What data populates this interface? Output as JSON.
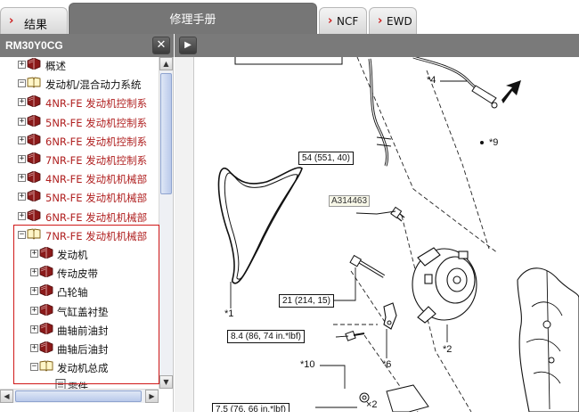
{
  "tabs": {
    "results": "结果",
    "manual": "修理手册",
    "ncf": "NCF",
    "ewd": "EWD"
  },
  "left_panel": {
    "title": "RM30Y0CG",
    "close_glyph": "✕",
    "tree": [
      {
        "label": "概述",
        "expander": "+",
        "icon": "closed-book",
        "indent": 0,
        "color": "dark"
      },
      {
        "label": "发动机/混合动力系统",
        "expander": "−",
        "icon": "open-book",
        "indent": 0,
        "color": "dark"
      },
      {
        "label": "4NR-FE 发动机控制系",
        "expander": "+",
        "icon": "closed-book",
        "indent": 1,
        "color": "red"
      },
      {
        "label": "5NR-FE 发动机控制系",
        "expander": "+",
        "icon": "closed-book",
        "indent": 1,
        "color": "red"
      },
      {
        "label": "6NR-FE 发动机控制系",
        "expander": "+",
        "icon": "closed-book",
        "indent": 1,
        "color": "red"
      },
      {
        "label": "7NR-FE 发动机控制系",
        "expander": "+",
        "icon": "closed-book",
        "indent": 1,
        "color": "red"
      },
      {
        "label": "4NR-FE 发动机机械部",
        "expander": "+",
        "icon": "closed-book",
        "indent": 1,
        "color": "red"
      },
      {
        "label": "5NR-FE 发动机机械部",
        "expander": "+",
        "icon": "closed-book",
        "indent": 1,
        "color": "red"
      },
      {
        "label": "6NR-FE 发动机机械部",
        "expander": "+",
        "icon": "closed-book",
        "indent": 1,
        "color": "red"
      },
      {
        "label": "7NR-FE 发动机机械部",
        "expander": "−",
        "icon": "open-book",
        "indent": 1,
        "color": "red"
      },
      {
        "label": "发动机",
        "expander": "+",
        "icon": "closed-book",
        "indent": 2,
        "color": "dark"
      },
      {
        "label": "传动皮带",
        "expander": "+",
        "icon": "closed-book",
        "indent": 2,
        "color": "dark"
      },
      {
        "label": "凸轮轴",
        "expander": "+",
        "icon": "closed-book",
        "indent": 2,
        "color": "dark"
      },
      {
        "label": "气缸盖衬垫",
        "expander": "+",
        "icon": "closed-book",
        "indent": 2,
        "color": "dark"
      },
      {
        "label": "曲轴前油封",
        "expander": "+",
        "icon": "closed-book",
        "indent": 2,
        "color": "dark"
      },
      {
        "label": "曲轴后油封",
        "expander": "+",
        "icon": "closed-book",
        "indent": 2,
        "color": "dark"
      },
      {
        "label": "发动机总成",
        "expander": "−",
        "icon": "open-book",
        "indent": 2,
        "color": "dark"
      },
      {
        "label": "零件",
        "expander": "",
        "icon": "page",
        "indent": 3,
        "color": "dark"
      }
    ]
  },
  "right_panel": {
    "expand_glyph": "▶"
  },
  "diagram": {
    "illustration_code": "A314463",
    "torque_callouts": [
      "54 (551, 40)",
      "21 (214, 15)",
      "8.4 (86, 74 in.*lbf)",
      "7.5 (76, 66 in.*lbf)"
    ],
    "part_labels": [
      "*4",
      "*9",
      "*1",
      "*2",
      "*6",
      "*10",
      "×2"
    ]
  }
}
